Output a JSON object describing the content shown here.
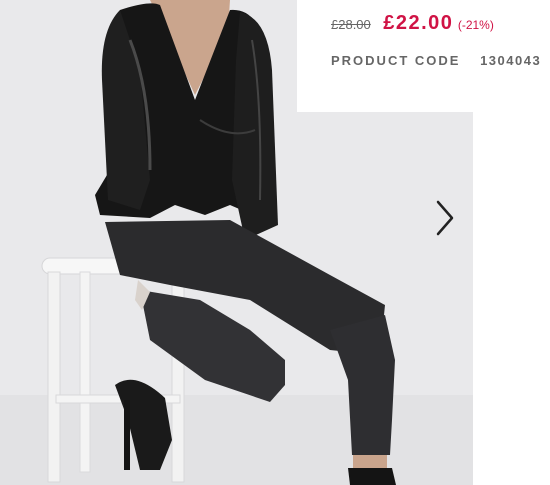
{
  "product": {
    "image_alt": "Model wearing black satin wrap blouse with peplum, black skinny jeans and black heeled sandals, sitting on a white stool",
    "old_price": "£28.00",
    "price": "£22.00",
    "discount": "(-21%)",
    "code_label": "PRODUCT CODE",
    "code_value": "1304043"
  },
  "gallery": {
    "next_icon": "chevron-right-icon"
  },
  "colors": {
    "sale_red": "#d01345",
    "muted_grey": "#666666",
    "backdrop": "#e9e9eb"
  }
}
